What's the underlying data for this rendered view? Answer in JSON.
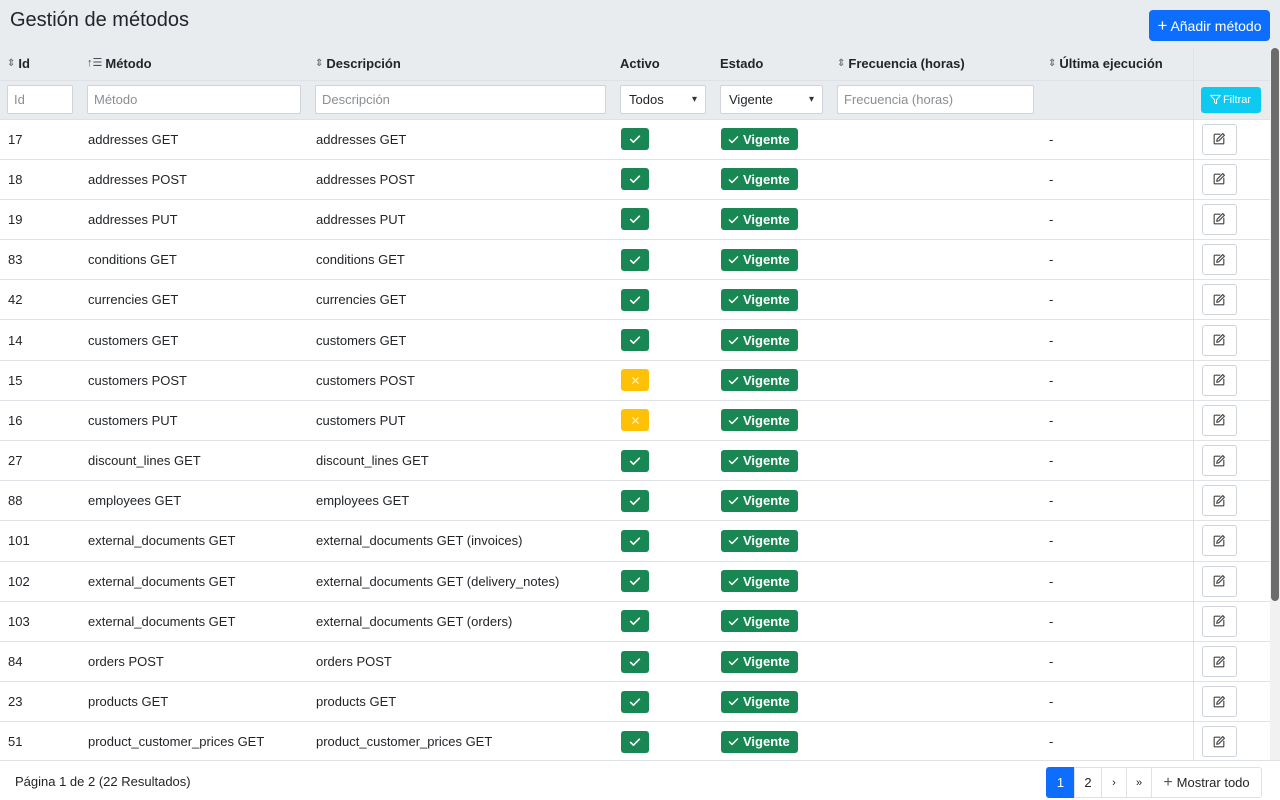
{
  "header": {
    "title": "Gestión de métodos",
    "add_button": "Añadir método"
  },
  "columns": {
    "id": "Id",
    "metodo": "Método",
    "descripcion": "Descripción",
    "activo": "Activo",
    "estado": "Estado",
    "frecuencia": "Frecuencia (horas)",
    "ultima": "Última ejecución"
  },
  "filters": {
    "id_placeholder": "Id",
    "metodo_placeholder": "Método",
    "descripcion_placeholder": "Descripción",
    "activo_value": "Todos",
    "estado_value": "Vigente",
    "frecuencia_placeholder": "Frecuencia (horas)",
    "filter_button": "Filtrar"
  },
  "rows": [
    {
      "id": "17",
      "metodo": "addresses GET",
      "descripcion": "addresses GET",
      "activo": true,
      "estado": "Vigente",
      "frecuencia": "",
      "ultima": "-"
    },
    {
      "id": "18",
      "metodo": "addresses POST",
      "descripcion": "addresses POST",
      "activo": true,
      "estado": "Vigente",
      "frecuencia": "",
      "ultima": "-"
    },
    {
      "id": "19",
      "metodo": "addresses PUT",
      "descripcion": "addresses PUT",
      "activo": true,
      "estado": "Vigente",
      "frecuencia": "",
      "ultima": "-"
    },
    {
      "id": "83",
      "metodo": "conditions GET",
      "descripcion": "conditions GET",
      "activo": true,
      "estado": "Vigente",
      "frecuencia": "",
      "ultima": "-"
    },
    {
      "id": "42",
      "metodo": "currencies GET",
      "descripcion": "currencies GET",
      "activo": true,
      "estado": "Vigente",
      "frecuencia": "",
      "ultima": "-"
    },
    {
      "id": "14",
      "metodo": "customers GET",
      "descripcion": "customers GET",
      "activo": true,
      "estado": "Vigente",
      "frecuencia": "",
      "ultima": "-"
    },
    {
      "id": "15",
      "metodo": "customers POST",
      "descripcion": "customers POST",
      "activo": false,
      "estado": "Vigente",
      "frecuencia": "",
      "ultima": "-"
    },
    {
      "id": "16",
      "metodo": "customers PUT",
      "descripcion": "customers PUT",
      "activo": false,
      "estado": "Vigente",
      "frecuencia": "",
      "ultima": "-"
    },
    {
      "id": "27",
      "metodo": "discount_lines GET",
      "descripcion": "discount_lines GET",
      "activo": true,
      "estado": "Vigente",
      "frecuencia": "",
      "ultima": "-"
    },
    {
      "id": "88",
      "metodo": "employees GET",
      "descripcion": "employees GET",
      "activo": true,
      "estado": "Vigente",
      "frecuencia": "",
      "ultima": "-"
    },
    {
      "id": "101",
      "metodo": "external_documents GET",
      "descripcion": "external_documents GET (invoices)",
      "activo": true,
      "estado": "Vigente",
      "frecuencia": "",
      "ultima": "-"
    },
    {
      "id": "102",
      "metodo": "external_documents GET",
      "descripcion": "external_documents GET (delivery_notes)",
      "activo": true,
      "estado": "Vigente",
      "frecuencia": "",
      "ultima": "-"
    },
    {
      "id": "103",
      "metodo": "external_documents GET",
      "descripcion": "external_documents GET (orders)",
      "activo": true,
      "estado": "Vigente",
      "frecuencia": "",
      "ultima": "-"
    },
    {
      "id": "84",
      "metodo": "orders POST",
      "descripcion": "orders POST",
      "activo": true,
      "estado": "Vigente",
      "frecuencia": "",
      "ultima": "-"
    },
    {
      "id": "23",
      "metodo": "products GET",
      "descripcion": "products GET",
      "activo": true,
      "estado": "Vigente",
      "frecuencia": "",
      "ultima": "-"
    },
    {
      "id": "51",
      "metodo": "product_customer_prices GET",
      "descripcion": "product_customer_prices GET",
      "activo": true,
      "estado": "Vigente",
      "frecuencia": "",
      "ultima": "-"
    }
  ],
  "icons": {
    "active_check": "check-icon",
    "inactive_x": "x-icon",
    "edit": "edit-icon",
    "sort": "sort-icon"
  },
  "colors": {
    "primary": "#0d6efd",
    "success": "#198754",
    "warning": "#ffc107",
    "info": "#0dcaf0"
  },
  "footer": {
    "page_info": "Página 1 de 2 (22 Resultados)",
    "pages": [
      "1",
      "2"
    ],
    "next": "›",
    "last": "»",
    "show_all": "Mostrar todo"
  }
}
